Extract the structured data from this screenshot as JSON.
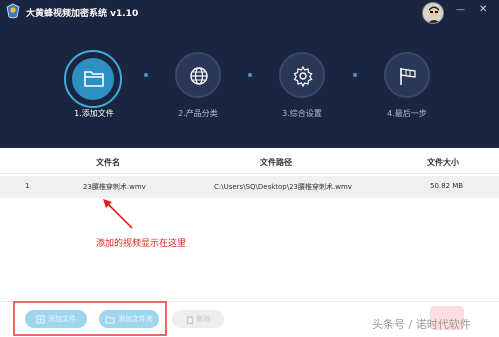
{
  "app": {
    "title": "大黄蜂视频加密系统 v1.10",
    "window_controls": {
      "minimize": "—",
      "close": "✕"
    }
  },
  "steps": [
    {
      "label": "1.添加文件",
      "icon": "folder-icon",
      "active": true
    },
    {
      "label": "2.产品分类",
      "icon": "globe-icon",
      "active": false
    },
    {
      "label": "3.综合设置",
      "icon": "gear-icon",
      "active": false
    },
    {
      "label": "4.最后一步",
      "icon": "flag-icon",
      "active": false
    }
  ],
  "table": {
    "headers": {
      "name": "文件名",
      "path": "文件路径",
      "size": "文件大小"
    },
    "rows": [
      {
        "index": "1",
        "name": "23腰椎穿刺术.wmv",
        "path": "C:\\Users\\SQ\\Desktop\\23腰椎穿刺术.wmv",
        "size": "50.82 MB"
      }
    ]
  },
  "annotation": "添加的视频显示在这里",
  "footer": {
    "add_file": "添加文件",
    "add_folder": "添加文件夹",
    "delete": "删除"
  },
  "watermark": "头条号 / 诺时代软件",
  "colors": {
    "header_bg": "#1b2540",
    "accent": "#2e8fc1",
    "annotation": "#e0221f"
  }
}
